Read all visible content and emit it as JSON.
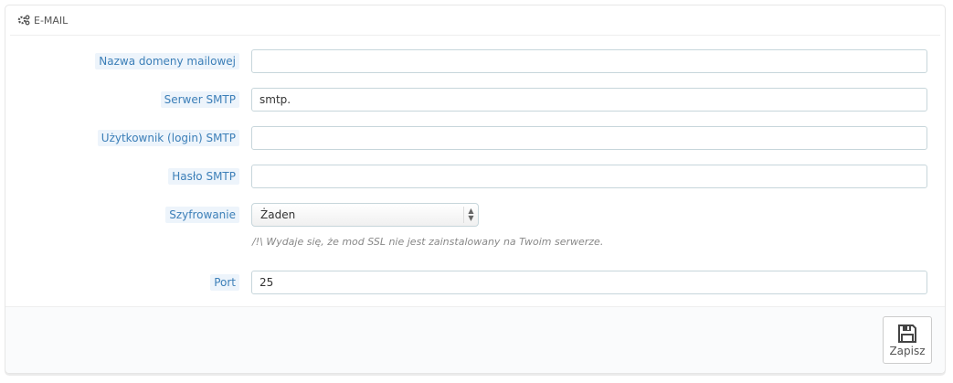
{
  "panel": {
    "title": "E-MAIL",
    "icon": "cogs-icon"
  },
  "fields": [
    {
      "label": "Nazwa domeny mailowej",
      "value": ""
    },
    {
      "label": "Serwer SMTP",
      "value": "smtp."
    },
    {
      "label": "Użytkownik (login) SMTP",
      "value": ""
    },
    {
      "label": "Hasło SMTP",
      "value": ""
    }
  ],
  "encryption": {
    "label": "Szyfrowanie",
    "value": "Żaden",
    "help": "/!\\ Wydaje się, że mod SSL nie jest zainstalowany na Twoim serwerze."
  },
  "port": {
    "label": "Port",
    "value": "25"
  },
  "footer": {
    "save_label": "Zapisz",
    "save_icon": "floppy-disk-icon"
  },
  "colors": {
    "label_bg": "#edf4fb",
    "label_text": "#3c7fb8"
  }
}
